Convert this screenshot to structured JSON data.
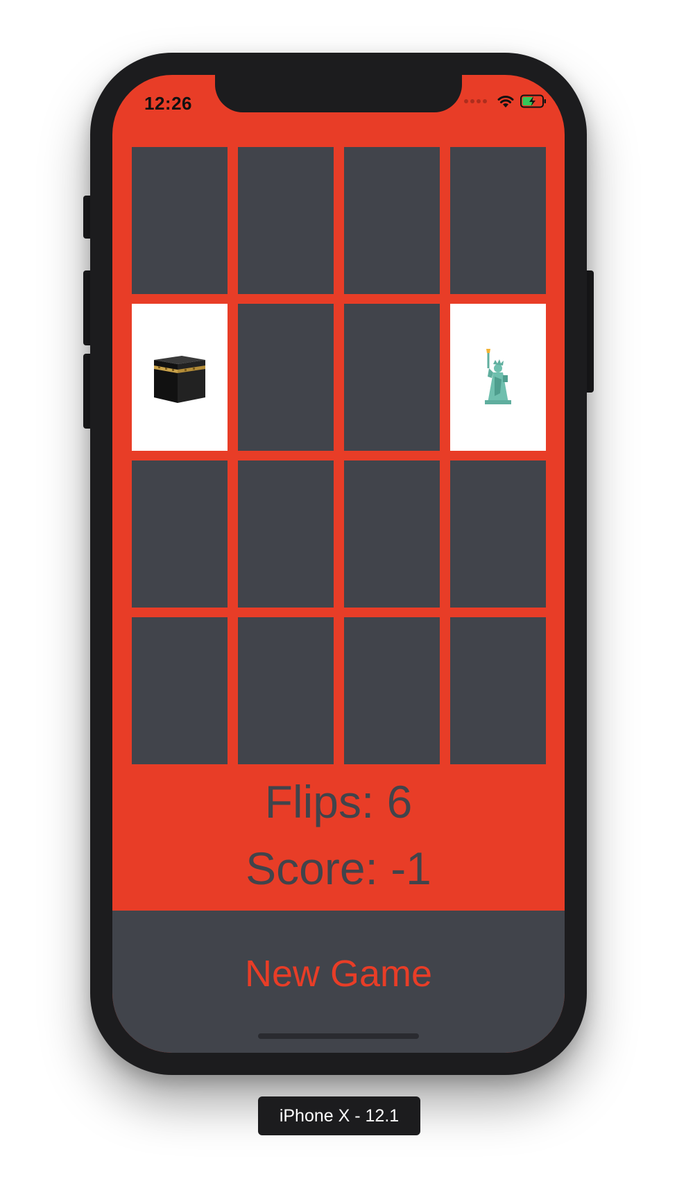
{
  "status_bar": {
    "time": "12:26",
    "icons": [
      "signal-dots-icon",
      "wifi-icon",
      "battery-charging-icon"
    ]
  },
  "cards": [
    {
      "face_up": false,
      "symbol": ""
    },
    {
      "face_up": false,
      "symbol": ""
    },
    {
      "face_up": false,
      "symbol": ""
    },
    {
      "face_up": false,
      "symbol": ""
    },
    {
      "face_up": true,
      "symbol": "kaaba"
    },
    {
      "face_up": false,
      "symbol": ""
    },
    {
      "face_up": false,
      "symbol": ""
    },
    {
      "face_up": true,
      "symbol": "statue-of-liberty"
    },
    {
      "face_up": false,
      "symbol": ""
    },
    {
      "face_up": false,
      "symbol": ""
    },
    {
      "face_up": false,
      "symbol": ""
    },
    {
      "face_up": false,
      "symbol": ""
    },
    {
      "face_up": false,
      "symbol": ""
    },
    {
      "face_up": false,
      "symbol": ""
    },
    {
      "face_up": false,
      "symbol": ""
    },
    {
      "face_up": false,
      "symbol": ""
    }
  ],
  "game": {
    "flips_text": "Flips: 6",
    "score_text": "Score: -1",
    "new_game_label": "New Game"
  },
  "device": {
    "label": "iPhone X - 12.1"
  },
  "colors": {
    "background": "#e83d27",
    "card_back": "#41444b",
    "card_face": "#ffffff",
    "text": "#41444b",
    "accent": "#e83d27"
  }
}
